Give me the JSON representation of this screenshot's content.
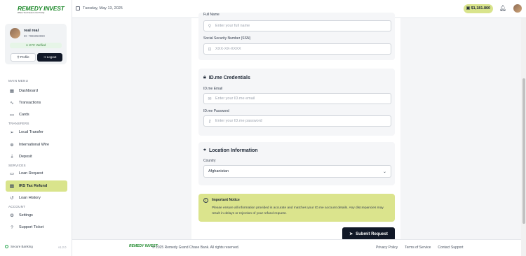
{
  "brand": {
    "name": "REMEDY INVEST",
    "tagline": "Where Your Future Is Our Priority"
  },
  "user": {
    "name": "real real",
    "id_label": "ID: 7996050990",
    "kyc": "KYC Verified",
    "profile_label": "Profile",
    "logout_label": "Logout"
  },
  "sidebar": {
    "main_menu": "MAIN MENU",
    "transfers": "TRANSFERS",
    "services": "SERVICES",
    "account": "ACCOUNT",
    "items": [
      {
        "label": "Dashboard",
        "icon": "grid-icon"
      },
      {
        "label": "Transactions",
        "icon": "activity-icon"
      },
      {
        "label": "Cards",
        "icon": "card-icon"
      },
      {
        "label": "Local Transfer",
        "icon": "send-icon"
      },
      {
        "label": "International Wire",
        "icon": "globe-icon"
      },
      {
        "label": "Deposit",
        "icon": "download-icon"
      },
      {
        "label": "Loan Request",
        "icon": "loan-icon"
      },
      {
        "label": "IRS Tax Refund",
        "icon": "document-icon",
        "active": true
      },
      {
        "label": "Loan History",
        "icon": "history-icon"
      },
      {
        "label": "Settings",
        "icon": "gear-icon"
      },
      {
        "label": "Support Ticket",
        "icon": "help-icon"
      }
    ],
    "secure": "Secure Banking",
    "version": "v1.2.0"
  },
  "topbar": {
    "date": "Tuesday, May 13, 2025",
    "balance": "$1,181.860"
  },
  "form": {
    "full_name": {
      "label": "Full Name",
      "placeholder": "Enter your full name"
    },
    "ssn": {
      "label": "Social Security Number (SSN)",
      "placeholder": "XXX-XX-XXXX"
    },
    "idme_title": "ID.me Credentials",
    "idme_email": {
      "label": "ID.me Email",
      "placeholder": "Enter your ID.me email"
    },
    "idme_password": {
      "label": "ID.me Password",
      "placeholder": "Enter your ID.me password"
    },
    "location_title": "Location Information",
    "country": {
      "label": "Country",
      "value": "Afghanistan"
    },
    "notice_title": "Important Notice",
    "notice_text": "Please ensure all information provided is accurate and matches your ID.me account details. Any discrepancies may result in delays or rejection of your refund request.",
    "submit_label": "Submit Request"
  },
  "footer": {
    "logo": "REMEDY INVEST",
    "copyright": "© 2025 Remedy Grand Chase Bank. All rights reserved.",
    "links": [
      "Privacy Policy",
      "Terms of Service",
      "Contact Support"
    ]
  },
  "colors": {
    "accent": "#d9e48c",
    "dark": "#111827",
    "brand_green": "#1f8a2c"
  }
}
